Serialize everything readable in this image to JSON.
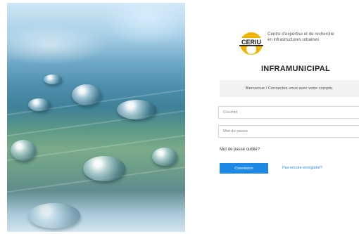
{
  "logo": {
    "acronym": "CERIU",
    "org_line1": "Centre d'expertise et de recherche",
    "org_line2": "en infrastructures urbaines",
    "colors": {
      "gold": "#f0b400",
      "dark": "#1a1a1a"
    }
  },
  "app_name": "INFRAMUNICIPAL",
  "welcome_message": "Bienvenue ! Connectez-vous avec votre compte.",
  "form": {
    "email_placeholder": "Courriel",
    "password_placeholder": "Mot de passe",
    "forgot_password": "Mot de passe oublié?",
    "login_button": "Connexion",
    "register_link": "Pas encore enregistré?"
  },
  "colors": {
    "primary": "#1e88e5",
    "welcome_bg": "#f2f2f2"
  }
}
